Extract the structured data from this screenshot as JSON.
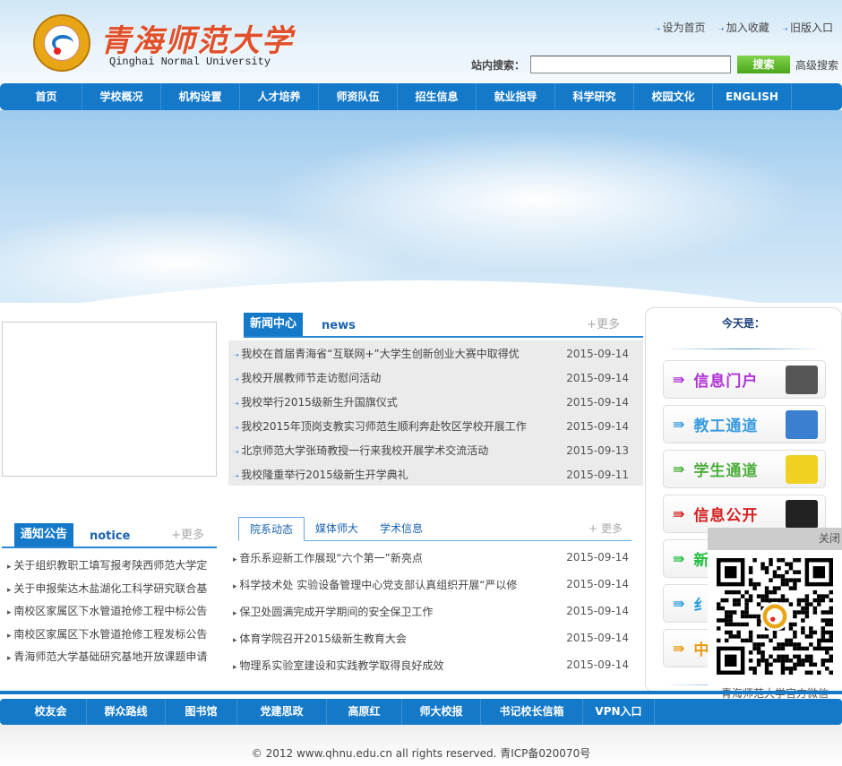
{
  "header": {
    "logo_cn": "青海师范大学",
    "logo_en": "Qinghai Normal University",
    "links": [
      "设为首页",
      "加入收藏",
      "旧版入口"
    ],
    "search": {
      "label": "站内搜索：",
      "value": "",
      "button": "搜索",
      "advanced": "高级搜索"
    }
  },
  "nav": [
    "首页",
    "学校概况",
    "机构设置",
    "人才培养",
    "师资队伍",
    "招生信息",
    "就业指导",
    "科学研究",
    "校园文化",
    "ENGLISH"
  ],
  "news": {
    "tag": "新闻中心",
    "en": "news",
    "more": "+更多",
    "items": [
      {
        "title": "我校在首届青海省“互联网+”大学生创新创业大赛中取得优",
        "date": "2015-09-14"
      },
      {
        "title": "我校开展教师节走访慰问活动",
        "date": "2015-09-14"
      },
      {
        "title": "我校举行2015级新生升国旗仪式",
        "date": "2015-09-14"
      },
      {
        "title": "我校2015年顶岗支教实习师范生顺利奔赴牧区学校开展工作",
        "date": "2015-09-14"
      },
      {
        "title": "北京师范大学张琦教授一行来我校开展学术交流活动",
        "date": "2015-09-13"
      },
      {
        "title": "我校隆重举行2015级新生开学典礼",
        "date": "2015-09-11"
      }
    ]
  },
  "notice": {
    "tag": "通知公告",
    "en": "notice",
    "more": "+更多",
    "items": [
      "关于组织教职工填写报考陕西师范大学定",
      "关于申报柴达木盐湖化工科学研究联合基",
      "南校区家属区下水管道抢修工程中标公告",
      "南校区家属区下水管道抢修工程发标公告",
      "青海师范大学基础研究基地开放课题申请"
    ]
  },
  "dept": {
    "tabs": [
      "院系动态",
      "媒体师大",
      "学术信息"
    ],
    "more": "+ 更多",
    "items": [
      {
        "title": "音乐系迎新工作展现“六个第一”新亮点",
        "date": "2015-09-14"
      },
      {
        "title": "科学技术处 实验设备管理中心党支部认真组织开展“严以修",
        "date": "2015-09-14"
      },
      {
        "title": "保卫处圆满完成开学期间的安全保卫工作",
        "date": "2015-09-14"
      },
      {
        "title": "体育学院召开2015级新生教育大会",
        "date": "2015-09-14"
      },
      {
        "title": "物理系实验室建设和实践教学取得良好成效",
        "date": "2015-09-14"
      }
    ]
  },
  "right": {
    "today": "今天是：",
    "buttons": [
      {
        "label": "信息门户",
        "color": "#b030d8",
        "icon": "house-at-icon"
      },
      {
        "label": "教工通道",
        "color": "#3a9be0",
        "icon": "computer-icon"
      },
      {
        "label": "学生通道",
        "color": "#4cae3c",
        "icon": "notebook-icon"
      },
      {
        "label": "信息公开",
        "color": "#d42020",
        "icon": "monitor-icon"
      },
      {
        "label": "新",
        "color": "#20c040",
        "icon": ""
      },
      {
        "label": "纟",
        "color": "#2a9ae0",
        "icon": ""
      },
      {
        "label": "中",
        "color": "#e89a10",
        "icon": ""
      }
    ]
  },
  "qr": {
    "close": "关闭",
    "caption": "青海师范大学官方微信"
  },
  "footer_nav": [
    "校友会",
    "群众路线",
    "图书馆",
    "党建思政",
    "高原红",
    "师大校报",
    "书记校长信箱",
    "VPN入口"
  ],
  "copyright": "© 2012 www.qhnu.edu.cn all rights reserved. 青ICP备020070号"
}
